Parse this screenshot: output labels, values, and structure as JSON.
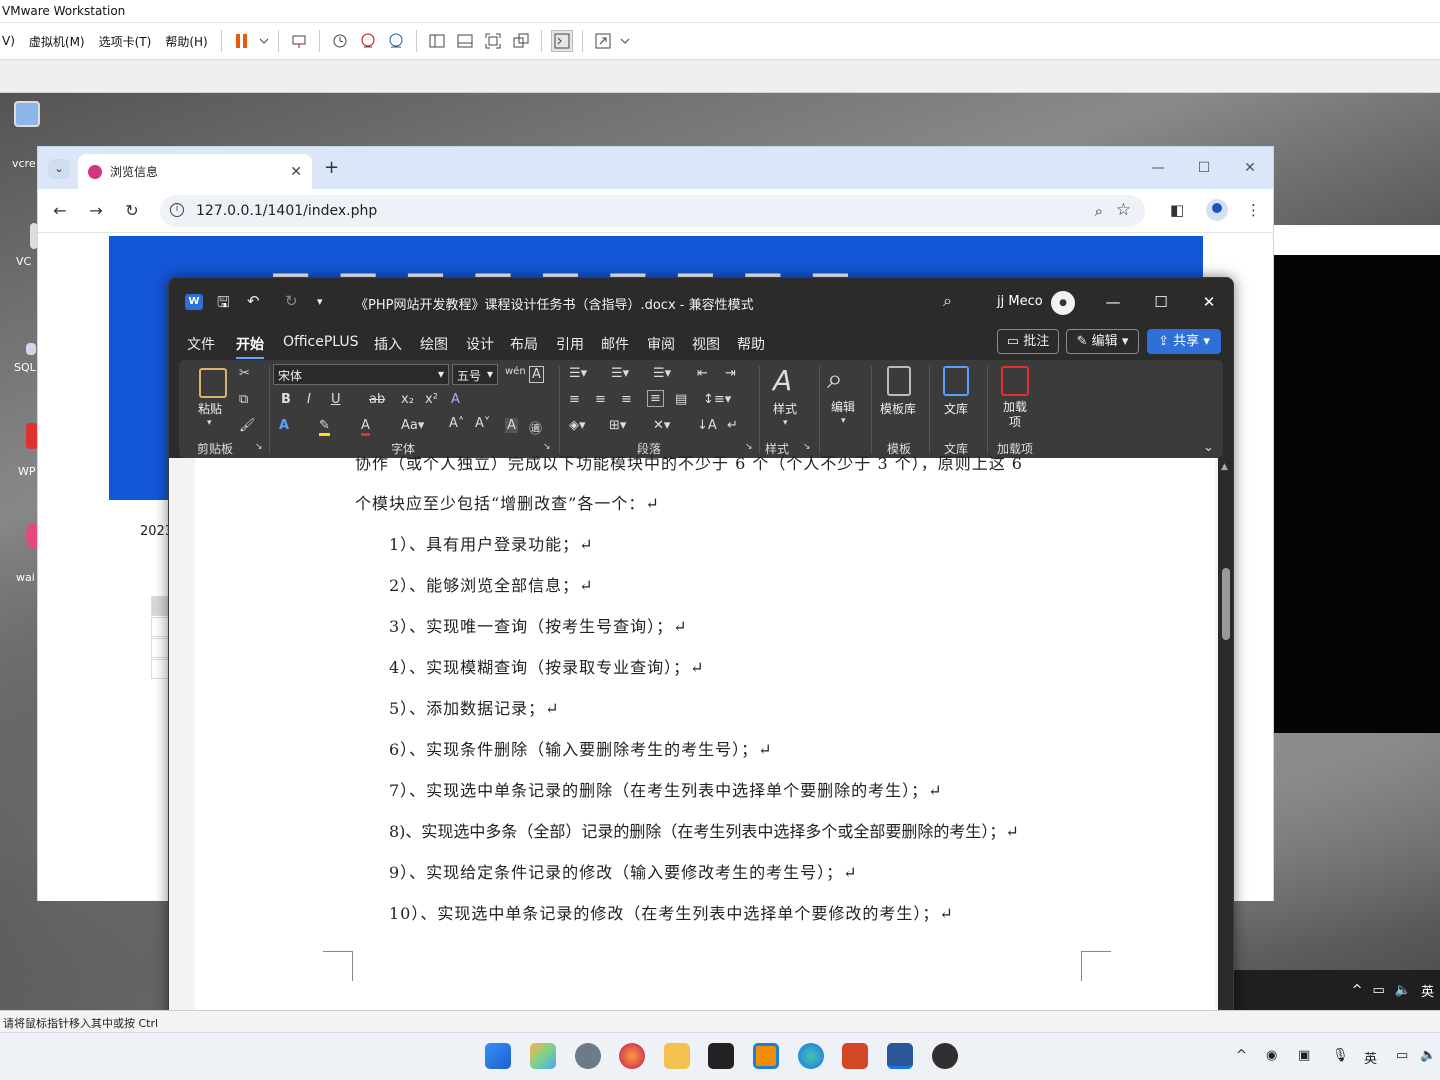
{
  "vmware": {
    "title": "VMware Workstation",
    "menus": [
      "V)",
      "虚拟机(M)",
      "选项卡(T)",
      "帮助(H)"
    ],
    "status_hint": "请将鼠标指针移入其中或按 Ctrl"
  },
  "desktop": {
    "icons": [
      "vcre",
      "VC",
      "SQL",
      "WP",
      "wai"
    ]
  },
  "browser": {
    "tab_title": "浏览信息",
    "url": "127.0.0.1/1401/index.php",
    "year_text": "2023"
  },
  "word": {
    "doc_title": "《PHP网站开发教程》课程设计任务书（含指导）.docx  -  兼容性模式",
    "user_name": "jj Meco",
    "menus": [
      "文件",
      "开始",
      "OfficePLUS",
      "插入",
      "绘图",
      "设计",
      "布局",
      "引用",
      "邮件",
      "审阅",
      "视图",
      "帮助"
    ],
    "active_menu": "开始",
    "comment_label": "批注",
    "edit_label": "编辑",
    "share_label": "共享",
    "font_name": "宋体",
    "font_size": "五号",
    "groups": {
      "clipboard": "剪贴板",
      "font": "字体",
      "paragraph": "段落",
      "styles": "样式",
      "template": "模板",
      "library": "文库",
      "addins": "加载项"
    },
    "big_buttons": {
      "paste": "粘贴",
      "styles": "样式",
      "editing": "编辑",
      "template_lib": "模板库",
      "library": "文库",
      "addins": "加载项"
    },
    "doc_lines": [
      "协作（或个人独立）完成以下功能模块中的不少于 6 个（个人不少于 3 个），原则上这 6",
      "个模块应至少包括“增删改查”各一个：↵",
      "1）、具有用户登录功能；↵",
      "2）、能够浏览全部信息；↵",
      "3）、实现唯一查询（按考生号查询）；↵",
      "4）、实现模糊查询（按录取专业查询）；↵",
      "5）、添加数据记录；↵",
      "6）、实现条件删除（输入要删除考生的考生号）；↵",
      "7）、实现选中单条记录的删除（在考生列表中选择单个要删除的考生）；↵",
      "8)、实现选中多条（全部）记录的删除（在考生列表中选择多个或全部要删除的考生）；↵",
      "9）、实现给定条件记录的修改（输入要修改考生的考生号）；↵",
      "10）、实现选中单条记录的修改（在考生列表中选择单个要修改的考生）；↵"
    ]
  },
  "taskbar": {
    "tray_ime": "英"
  }
}
